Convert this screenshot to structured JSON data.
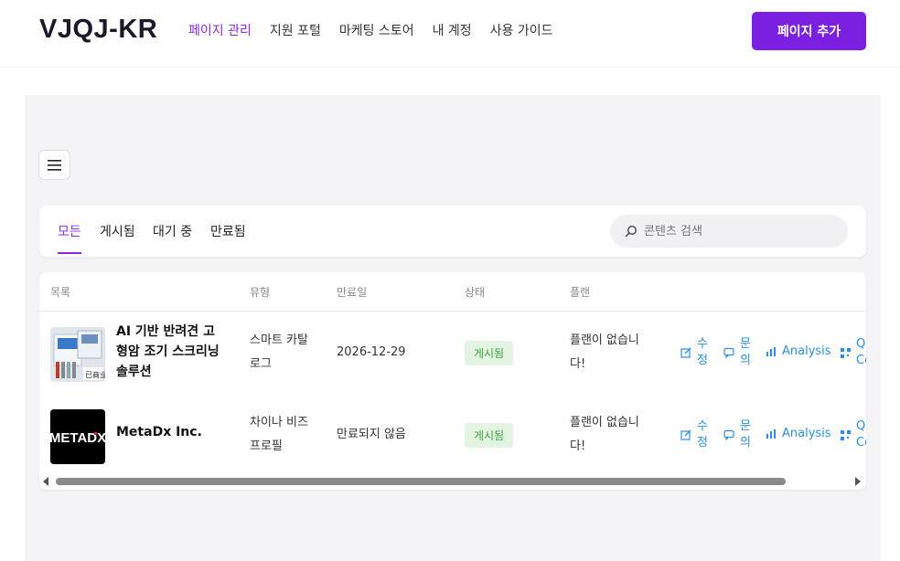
{
  "header": {
    "logo": "VJQJ-KR",
    "nav": [
      "페이지 관리",
      "지원 포털",
      "마케팅 스토어",
      "내 계정",
      "사용 가이드"
    ],
    "add_button": "페이지 추가"
  },
  "tabs": [
    "모든",
    "게시됨",
    "대기 중",
    "만료됨"
  ],
  "search": {
    "placeholder": "콘텐츠 검색",
    "value": ""
  },
  "table": {
    "columns": [
      "목록",
      "유형",
      "만료일",
      "상태",
      "플랜"
    ],
    "rows": [
      {
        "name_lines": [
          "AI 기반 반려견 고",
          "형암 조기 스크리닝",
          "솔루션"
        ],
        "type_lines": [
          "스마트 카탈",
          "로그"
        ],
        "expiry": "2026-12-29",
        "status": "게시됨",
        "plan_lines": [
          "플랜이 없습니",
          "다!"
        ],
        "actions": {
          "edit": [
            "수",
            "정"
          ],
          "inquiry": [
            "문",
            "의"
          ],
          "analysis": "Analysis",
          "qr": [
            "QR",
            "Co"
          ]
        }
      },
      {
        "name_lines": [
          "MetaDx Inc."
        ],
        "logo_text": "METADX",
        "type_lines": [
          "차이나 비즈",
          "프로필"
        ],
        "expiry": "만료되지 않음",
        "status": "게시됨",
        "plan_lines": [
          "플랜이 없습니",
          "다!"
        ],
        "actions": {
          "edit": [
            "수",
            "정"
          ],
          "inquiry": [
            "문",
            "의"
          ],
          "analysis": "Analysis",
          "qr": [
            "QR",
            "Co"
          ]
        }
      }
    ]
  },
  "colors": {
    "accent": "#8a2be2",
    "button": "#7b1fe0",
    "link": "#2b8ee6",
    "badge_bg": "#e3f4e3",
    "badge_text": "#3da33d"
  }
}
